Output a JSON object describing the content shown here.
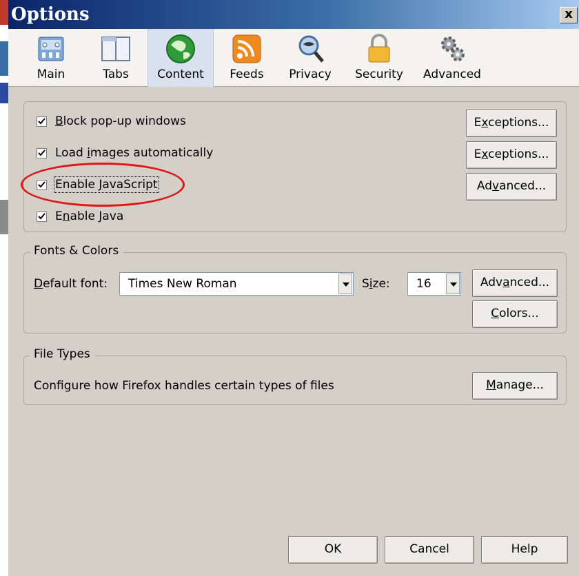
{
  "window": {
    "title": "Options",
    "close_glyph": "x"
  },
  "tabs": [
    {
      "label": "Main",
      "icon": "main-panel-icon"
    },
    {
      "label": "Tabs",
      "icon": "tabs-icon"
    },
    {
      "label": "Content",
      "icon": "globe-icon",
      "selected": true
    },
    {
      "label": "Feeds",
      "icon": "rss-feed-icon"
    },
    {
      "label": "Privacy",
      "icon": "mask-magnifier-icon"
    },
    {
      "label": "Security",
      "icon": "padlock-icon"
    },
    {
      "label": "Advanced",
      "icon": "gears-icon"
    }
  ],
  "content": {
    "block_popups": {
      "pre": "",
      "acc": "B",
      "post": "lock pop-up windows",
      "checked": true,
      "button_pre": "E",
      "button_acc": "x",
      "button_post": "ceptions..."
    },
    "load_images": {
      "pre": "Load ",
      "acc": "i",
      "post": "mages automatically",
      "checked": true,
      "button_pre": "E",
      "button_acc": "x",
      "button_post": "ceptions..."
    },
    "enable_js": {
      "pre": "Enable ",
      "acc": "J",
      "post": "avaScript",
      "checked": true,
      "button_pre": "Ad",
      "button_acc": "v",
      "button_post": "anced..."
    },
    "enable_java": {
      "pre": "E",
      "acc": "n",
      "post": "able Java",
      "checked": true
    }
  },
  "fonts": {
    "legend": "Fonts & Colors",
    "default_font_acc": "D",
    "default_font_post": "efault font:",
    "default_font_value": "Times New Roman",
    "size_pre": "S",
    "size_acc": "i",
    "size_post": "ze:",
    "size_value": "16",
    "advanced_pre": "Adv",
    "advanced_acc": "a",
    "advanced_post": "nced...",
    "colors_acc": "C",
    "colors_post": "olors..."
  },
  "file_types": {
    "legend": "File Types",
    "description": "Configure how Firefox handles certain types of files",
    "manage_acc": "M",
    "manage_post": "anage..."
  },
  "footer": {
    "ok": "OK",
    "cancel": "Cancel",
    "help": "Help"
  },
  "colors": {
    "highlight_ellipse": "#e01515",
    "selected_tab": "#d9e1ef",
    "dialog_bg": "#d4d0c8"
  }
}
